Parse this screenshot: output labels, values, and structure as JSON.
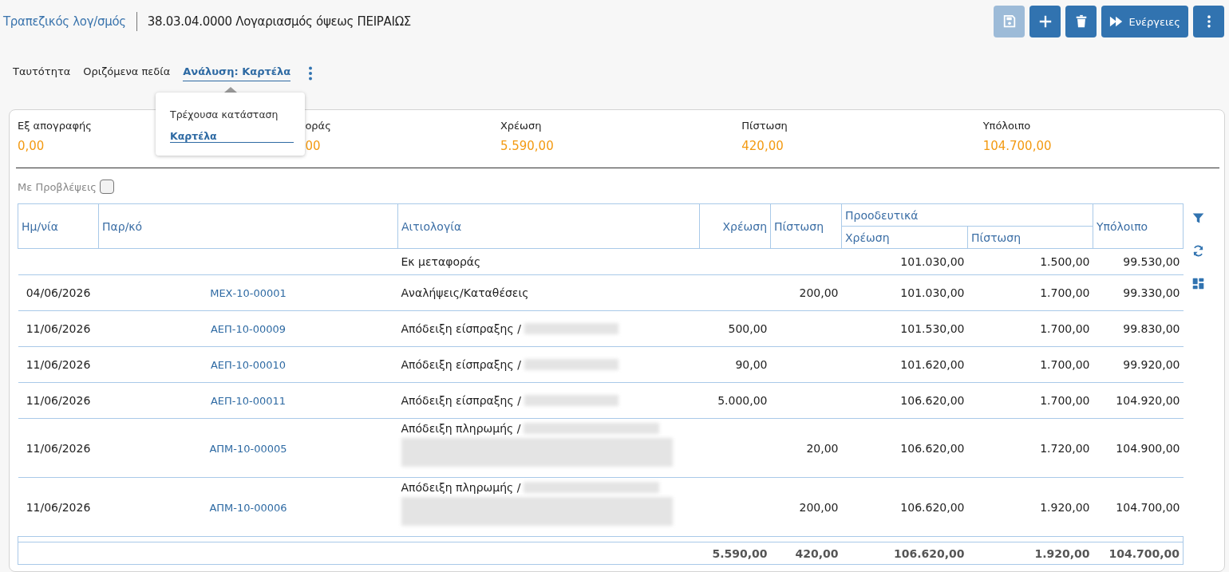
{
  "breadcrumb": {
    "parent": "Τραπεζικός λογ/σμός",
    "title": "38.03.04.0000 Λογαριασμός όψεως ΠΕΙΡΑΙΩΣ"
  },
  "toolbar": [
    {
      "kind": "save",
      "disabled": true
    },
    {
      "kind": "add",
      "disabled": false
    },
    {
      "kind": "delete",
      "disabled": false
    },
    {
      "kind": "actions",
      "label": "Ενέργειες",
      "disabled": false
    },
    {
      "kind": "more",
      "disabled": false
    }
  ],
  "tabs": [
    {
      "label": "Ταυτότητα",
      "selected": false
    },
    {
      "label": "Οριζόμενα πεδία",
      "selected": false
    },
    {
      "label": "Ανάλυση: Καρτέλα",
      "selected": true
    }
  ],
  "tab_menu": {
    "items": [
      {
        "label": "Τρέχουσα κατάσταση",
        "selected": false
      },
      {
        "label": "Καρτέλα",
        "selected": true
      }
    ]
  },
  "summary": [
    {
      "label": "Εξ απογραφής",
      "value": "0,00"
    },
    {
      "label": "οράς",
      "value": "00",
      "covered": true
    },
    {
      "label": "Χρέωση",
      "value": "5.590,00"
    },
    {
      "label": "Πίστωση",
      "value": "420,00"
    },
    {
      "label": "Υπόλοιπο",
      "value": "104.700,00"
    }
  ],
  "provisions": {
    "label": "Με Προβλέψεις",
    "checked": false
  },
  "table": {
    "columns": [
      "Ημ/νία",
      "Παρ/κό",
      "Αιτιολογία",
      "Χρέωση",
      "Πίστωση",
      "Υπόλοιπο"
    ],
    "group": "Προοδευτικά",
    "group_columns": [
      "Χρέωση",
      "Πίστωση"
    ],
    "rows": [
      {
        "date": "",
        "doc": "",
        "reason": "Εκ μεταφοράς",
        "debit": "",
        "credit": "",
        "cum_debit": "101.030,00",
        "cum_credit": "1.500,00",
        "balance": "99.530,00"
      },
      {
        "date": "04/06/2026",
        "doc": "ΜΕΧ-10-00001",
        "reason": "Αναλήψεις/Καταθέσεις",
        "debit": "",
        "credit": "200,00",
        "cum_debit": "101.030,00",
        "cum_credit": "1.700,00",
        "balance": "99.330,00"
      },
      {
        "date": "11/06/2026",
        "doc": "ΑΕΠ-10-00009",
        "reason": "Απόδειξη είσπραξης /",
        "kind": "redacted",
        "debit": "500,00",
        "credit": "",
        "cum_debit": "101.530,00",
        "cum_credit": "1.700,00",
        "balance": "99.830,00"
      },
      {
        "date": "11/06/2026",
        "doc": "ΑΕΠ-10-00010",
        "reason": "Απόδειξη είσπραξης /",
        "kind": "redacted",
        "debit": "90,00",
        "credit": "",
        "cum_debit": "101.620,00",
        "cum_credit": "1.700,00",
        "balance": "99.920,00"
      },
      {
        "date": "11/06/2026",
        "doc": "ΑΕΠ-10-00011",
        "reason": "Απόδειξη είσπραξης /",
        "kind": "redacted",
        "debit": "5.000,00",
        "credit": "",
        "cum_debit": "106.620,00",
        "cum_credit": "1.700,00",
        "balance": "104.920,00"
      },
      {
        "date": "11/06/2026",
        "doc": "ΑΠΜ-10-00005",
        "reason": "Απόδειξη πληρωμής /",
        "kind": "redacted-long",
        "debit": "",
        "credit": "20,00",
        "cum_debit": "106.620,00",
        "cum_credit": "1.720,00",
        "balance": "104.900,00"
      },
      {
        "date": "11/06/2026",
        "doc": "ΑΠΜ-10-00006",
        "reason": "Απόδειξη πληρωμής /",
        "kind": "redacted-long",
        "debit": "",
        "credit": "200,00",
        "cum_debit": "106.620,00",
        "cum_credit": "1.920,00",
        "balance": "104.700,00"
      }
    ],
    "totals": {
      "debit": "5.590,00",
      "credit": "420,00",
      "cum_debit": "106.620,00",
      "cum_credit": "1.920,00",
      "balance": "104.700,00"
    }
  },
  "side_tools": [
    {
      "kind": "filter"
    },
    {
      "kind": "refresh"
    },
    {
      "kind": "layout"
    }
  ]
}
